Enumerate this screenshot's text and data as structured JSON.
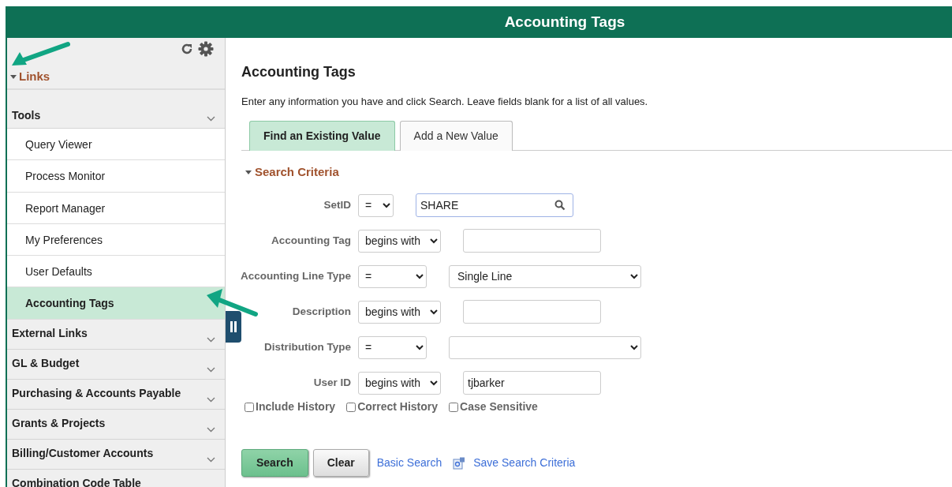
{
  "header": {
    "title": "Accounting Tags"
  },
  "sidebar": {
    "title": "Links",
    "expanded": true,
    "groups": [
      {
        "label": "Tools",
        "children": [
          {
            "label": "Query Viewer",
            "selected": false
          },
          {
            "label": "Process Monitor",
            "selected": false
          },
          {
            "label": "Report Manager",
            "selected": false
          },
          {
            "label": "My Preferences",
            "selected": false
          },
          {
            "label": "User Defaults",
            "selected": false
          },
          {
            "label": "Accounting Tags",
            "selected": true
          }
        ]
      },
      {
        "label": "External Links"
      },
      {
        "label": "GL & Budget"
      },
      {
        "label": "Purchasing & Accounts Payable"
      },
      {
        "label": "Grants & Projects"
      },
      {
        "label": "Billing/Customer Accounts"
      },
      {
        "label": "Combination Code Table"
      }
    ]
  },
  "page": {
    "title": "Accounting Tags",
    "instructions": "Enter any information you have and click Search. Leave fields blank for a list of all values.",
    "tabs": [
      {
        "label": "Find an Existing Value",
        "selected": true
      },
      {
        "label": "Add a New Value",
        "selected": false
      }
    ],
    "section": {
      "title": "Search Criteria",
      "expanded": true
    },
    "fields": [
      {
        "label": "SetID",
        "operator": "=",
        "kind": "lookup",
        "value": "SHARE"
      },
      {
        "label": "Accounting Tag",
        "operator": "begins with",
        "kind": "text"
      },
      {
        "label": "Accounting Line Type",
        "operator": "=",
        "kind": "select",
        "value": "Single Line"
      },
      {
        "label": "Description",
        "operator": "begins with",
        "kind": "text"
      },
      {
        "label": "Distribution Type",
        "operator": "=",
        "kind": "select"
      },
      {
        "label": "User ID",
        "operator": "begins with",
        "kind": "text",
        "value": "tjbarker"
      }
    ],
    "checkboxes": [
      {
        "label": "Include History",
        "checked": false
      },
      {
        "label": "Correct History",
        "checked": false
      },
      {
        "label": "Case Sensitive",
        "checked": false
      }
    ],
    "buttons": [
      {
        "label": "Search",
        "kind": "primary"
      },
      {
        "label": "Clear",
        "kind": "secondary"
      }
    ],
    "links": [
      {
        "label": "Basic Search",
        "kind": "plain"
      },
      {
        "label": "Save Search Criteria",
        "kind": "save"
      }
    ]
  }
}
